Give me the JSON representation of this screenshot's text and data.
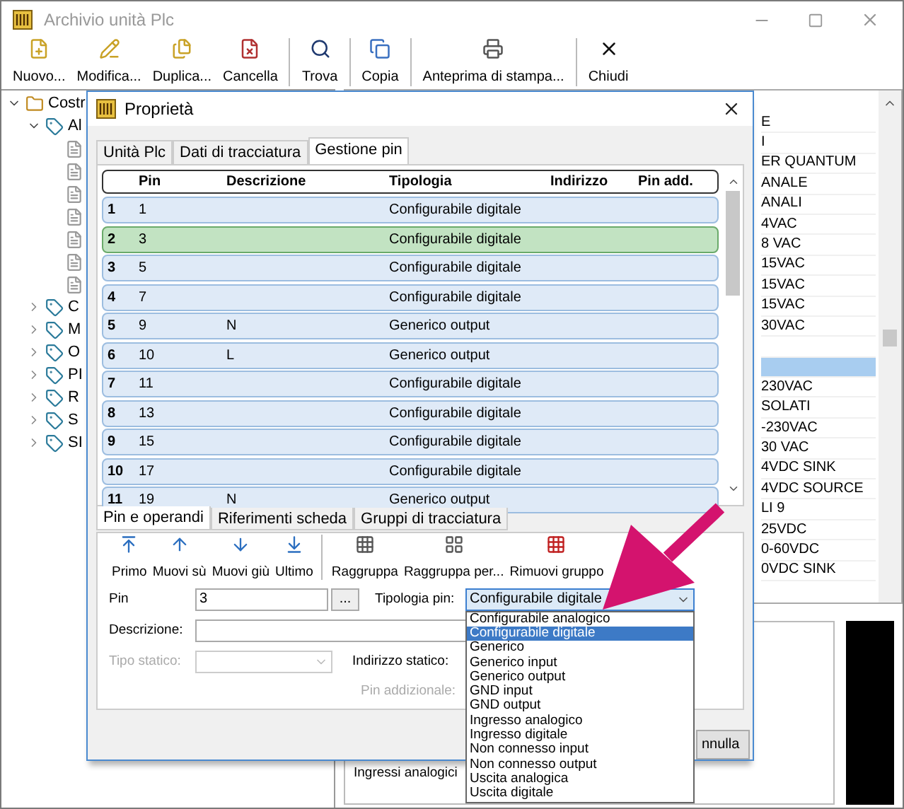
{
  "window": {
    "title": "Archivio unità Plc"
  },
  "toolbar": [
    {
      "label": "Nuovo...",
      "separator_before": false
    },
    {
      "label": "Modifica...",
      "separator_before": false
    },
    {
      "label": "Duplica...",
      "separator_before": false
    },
    {
      "label": "Cancella",
      "separator_before": false
    },
    {
      "label": "Trova",
      "separator_before": true
    },
    {
      "label": "Copia",
      "separator_before": true
    },
    {
      "label": "Anteprima di stampa...",
      "separator_before": true
    },
    {
      "label": "Chiudi",
      "separator_before": true
    }
  ],
  "tree": {
    "items": [
      {
        "kind": "root",
        "label": "Costr",
        "expanded": true,
        "children": [
          {
            "kind": "group",
            "label": "Al",
            "expanded": true,
            "children": [
              {
                "kind": "leaf"
              },
              {
                "kind": "leaf"
              },
              {
                "kind": "leaf"
              },
              {
                "kind": "leaf"
              },
              {
                "kind": "leaf"
              },
              {
                "kind": "leaf"
              },
              {
                "kind": "leaf"
              }
            ]
          },
          {
            "kind": "group",
            "label": "C",
            "expanded": false
          },
          {
            "kind": "group",
            "label": "M",
            "expanded": false
          },
          {
            "kind": "group",
            "label": "O",
            "expanded": false
          },
          {
            "kind": "group",
            "label": "PI",
            "expanded": false
          },
          {
            "kind": "group",
            "label": "R",
            "expanded": false
          },
          {
            "kind": "group",
            "label": "S",
            "expanded": false
          },
          {
            "kind": "group",
            "label": "SI",
            "expanded": false
          }
        ]
      }
    ]
  },
  "list": {
    "items": [
      {
        "text": "E",
        "selected": false
      },
      {
        "text": "I",
        "selected": false
      },
      {
        "text": "ER QUANTUM",
        "selected": false
      },
      {
        "text": "ANALE",
        "selected": false
      },
      {
        "text": "ANALI",
        "selected": false
      },
      {
        "text": "4VAC",
        "selected": false
      },
      {
        "text": "8 VAC",
        "selected": false
      },
      {
        "text": "15VAC",
        "selected": false
      },
      {
        "text": "15VAC",
        "selected": false
      },
      {
        "text": "15VAC",
        "selected": false
      },
      {
        "text": "30VAC",
        "selected": false
      },
      {
        "selected": false
      },
      {
        "selected": true
      },
      {
        "text": "230VAC",
        "selected": false
      },
      {
        "text": "SOLATI",
        "selected": false
      },
      {
        "text": "-230VAC",
        "selected": false
      },
      {
        "text": "30 VAC",
        "selected": false
      },
      {
        "text": "4VDC SINK",
        "selected": false
      },
      {
        "text": "4VDC SOURCE",
        "selected": false
      },
      {
        "text": "LI 9",
        "selected": false
      },
      {
        "text": "25VDC",
        "selected": false
      },
      {
        "text": "0-60VDC",
        "selected": false
      },
      {
        "text": "0VDC SINK",
        "selected": false
      }
    ]
  },
  "lower_panel": {
    "label": "Ingressi analogici"
  },
  "dialog": {
    "title": "Proprietà",
    "tabs": [
      {
        "label": "Unità Plc",
        "selected": false
      },
      {
        "label": "Dati di tracciatura",
        "selected": false
      },
      {
        "label": "Gestione pin",
        "selected": true
      }
    ],
    "grid": {
      "columns": [
        "Pin",
        "Descrizione",
        "Tipologia",
        "Indirizzo",
        "Pin add."
      ],
      "rows": [
        {
          "index": "1",
          "pin": "1",
          "tipologia": "Configurabile digitale",
          "selected": false
        },
        {
          "index": "2",
          "pin": "3",
          "tipologia": "Configurabile digitale",
          "selected": true
        },
        {
          "index": "3",
          "pin": "5",
          "tipologia": "Configurabile digitale",
          "selected": false
        },
        {
          "index": "4",
          "pin": "7",
          "tipologia": "Configurabile digitale",
          "selected": false
        },
        {
          "index": "5",
          "pin": "9",
          "descrizione": "N",
          "tipologia": "Generico output",
          "selected": false
        },
        {
          "index": "6",
          "pin": "10",
          "descrizione": "L",
          "tipologia": "Generico output",
          "selected": false
        },
        {
          "index": "7",
          "pin": "11",
          "tipologia": "Configurabile digitale",
          "selected": false
        },
        {
          "index": "8",
          "pin": "13",
          "tipologia": "Configurabile digitale",
          "selected": false
        },
        {
          "index": "9",
          "pin": "15",
          "tipologia": "Configurabile digitale",
          "selected": false
        },
        {
          "index": "10",
          "pin": "17",
          "tipologia": "Configurabile digitale",
          "selected": false
        },
        {
          "index": "11",
          "pin": "19",
          "descrizione": "N",
          "tipologia": "Generico output",
          "selected": false
        }
      ]
    },
    "subtabs": [
      {
        "label": "Pin e operandi",
        "selected": true
      },
      {
        "label": "Riferimenti scheda",
        "selected": false
      },
      {
        "label": "Gruppi di tracciatura",
        "selected": false
      }
    ],
    "actions": [
      {
        "label": "Primo",
        "separator_before": false
      },
      {
        "label": "Muovi sù",
        "separator_before": false
      },
      {
        "label": "Muovi giù",
        "separator_before": false
      },
      {
        "label": "Ultimo",
        "separator_before": false
      },
      {
        "label": "Raggruppa",
        "separator_before": true
      },
      {
        "label": "Raggruppa per...",
        "separator_before": false
      },
      {
        "label": "Rimuovi gruppo",
        "separator_before": false
      }
    ],
    "form": {
      "pin": {
        "label": "Pin",
        "value": "3",
        "browse": "..."
      },
      "tipologia": {
        "label": "Tipologia pin:",
        "value": "Configurabile digitale",
        "expanded": true,
        "options": [
          {
            "label": "Configurabile analogico",
            "selected": false
          },
          {
            "label": "Configurabile digitale",
            "selected": true
          },
          {
            "label": "Generico",
            "selected": false
          },
          {
            "label": "Generico input",
            "selected": false
          },
          {
            "label": "Generico output",
            "selected": false
          },
          {
            "label": "GND input",
            "selected": false
          },
          {
            "label": "GND output",
            "selected": false
          },
          {
            "label": "Ingresso analogico",
            "selected": false
          },
          {
            "label": "Ingresso digitale",
            "selected": false
          },
          {
            "label": "Non connesso input",
            "selected": false
          },
          {
            "label": "Non connesso output",
            "selected": false
          },
          {
            "label": "Uscita analogica",
            "selected": false
          },
          {
            "label": "Uscita digitale",
            "selected": false
          }
        ]
      },
      "descrizione": {
        "label": "Descrizione:"
      },
      "tipo_statico": {
        "label": "Tipo statico:",
        "disabled": true
      },
      "indirizzo_statico": {
        "label": "Indirizzo statico:"
      },
      "pin_addizionale": {
        "label": "Pin addizionale:",
        "disabled": true
      }
    },
    "buttons": [
      "nnulla"
    ]
  }
}
